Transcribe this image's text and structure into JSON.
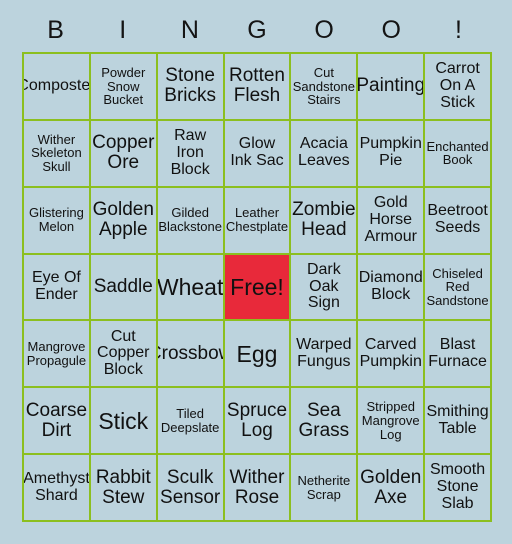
{
  "card": {
    "title_letters": [
      "B",
      "I",
      "N",
      "G",
      "O",
      "O",
      "!"
    ],
    "colors": {
      "background": "#bcd3dd",
      "grid_border": "#8cbf1f",
      "free_space": "#e8293a",
      "text": "#111111"
    },
    "grid_size": "7x7",
    "rows": [
      [
        "Composter",
        "Powder Snow Bucket",
        "Stone Bricks",
        "Rotten Flesh",
        "Cut Sandstone Stairs",
        "Painting",
        "Carrot On A Stick"
      ],
      [
        "Wither Skeleton Skull",
        "Copper Ore",
        "Raw Iron Block",
        "Glow Ink Sac",
        "Acacia Leaves",
        "Pumpkin Pie",
        "Enchanted Book"
      ],
      [
        "Glistering Melon",
        "Golden Apple",
        "Gilded Blackstone",
        "Leather Chestplate",
        "Zombie Head",
        "Gold Horse Armour",
        "Beetroot Seeds"
      ],
      [
        "Eye Of Ender",
        "Saddle",
        "Wheat",
        "Free!",
        "Dark Oak Sign",
        "Diamond Block",
        "Chiseled Red Sandstone"
      ],
      [
        "Mangrove Propagule",
        "Cut Copper Block",
        "Crossbow",
        "Egg",
        "Warped Fungus",
        "Carved Pumpkin",
        "Blast Furnace"
      ],
      [
        "Coarse Dirt",
        "Stick",
        "Tiled Deepslate",
        "Spruce Log",
        "Sea Grass",
        "Stripped Mangrove Log",
        "Smithing Table"
      ],
      [
        "Amethyst Shard",
        "Rabbit Stew",
        "Sculk Sensor",
        "Wither Rose",
        "Netherite Scrap",
        "Golden Axe",
        "Smooth Stone Slab"
      ]
    ],
    "free_space_cell": {
      "row": 3,
      "col": 3,
      "label": "Free!"
    }
  }
}
